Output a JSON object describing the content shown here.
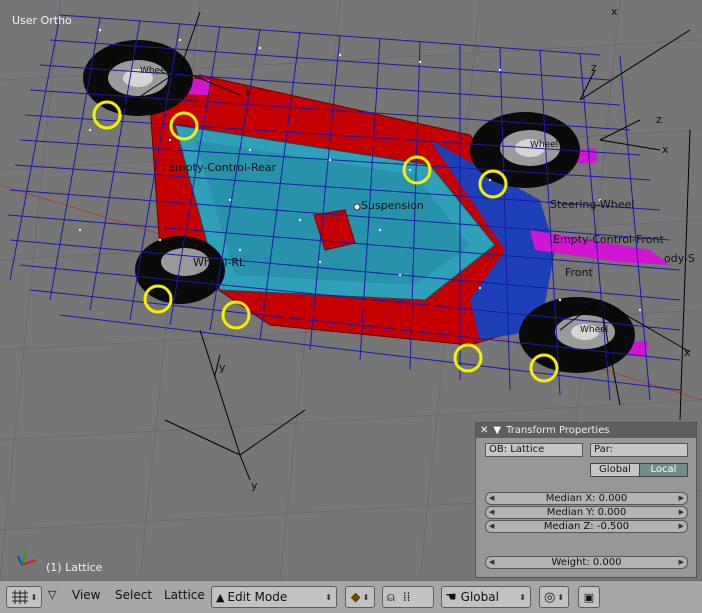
{
  "viewport": {
    "view_label": "User Ortho",
    "object_label": "(1) Lattice",
    "axis_labels": {
      "z_top": "z",
      "z_right": "z",
      "x_right": "x",
      "x_mid": "x",
      "x_far": "x",
      "x_top": "x",
      "y_bottom": "y",
      "y_left": "y"
    },
    "scene_labels": {
      "empty_control_rear": "Empty-Control-Rear",
      "suspension": "Suspension",
      "steering_wheel": "Steering-Wheel",
      "empty_control_front": "Empty-Control-Front",
      "front": "Front",
      "wheel_rl": "Wheel-RL",
      "wheel_fl": "Wheel",
      "wheel_fr": "Wheel",
      "wheel_rr": "Wheel",
      "body_s": "ody-S"
    }
  },
  "transform_panel": {
    "title": "Transform Properties",
    "ob_field": "OB: Lattice",
    "par_field": "Par:",
    "global_btn": "Global",
    "local_btn": "Local",
    "median_x": "Median X: 0.000",
    "median_y": "Median Y: 0.000",
    "median_z": "Median Z: -0.500",
    "weight": "Weight: 0.000"
  },
  "header": {
    "menu_view": "View",
    "menu_select": "Select",
    "menu_lattice": "Lattice",
    "mode": "Edit Mode",
    "orientation": "Global"
  },
  "colors": {
    "lattice": "#1a1aa8",
    "frame": "#c80000",
    "platform": "#2ea0b8",
    "selection": "#f5f000"
  }
}
